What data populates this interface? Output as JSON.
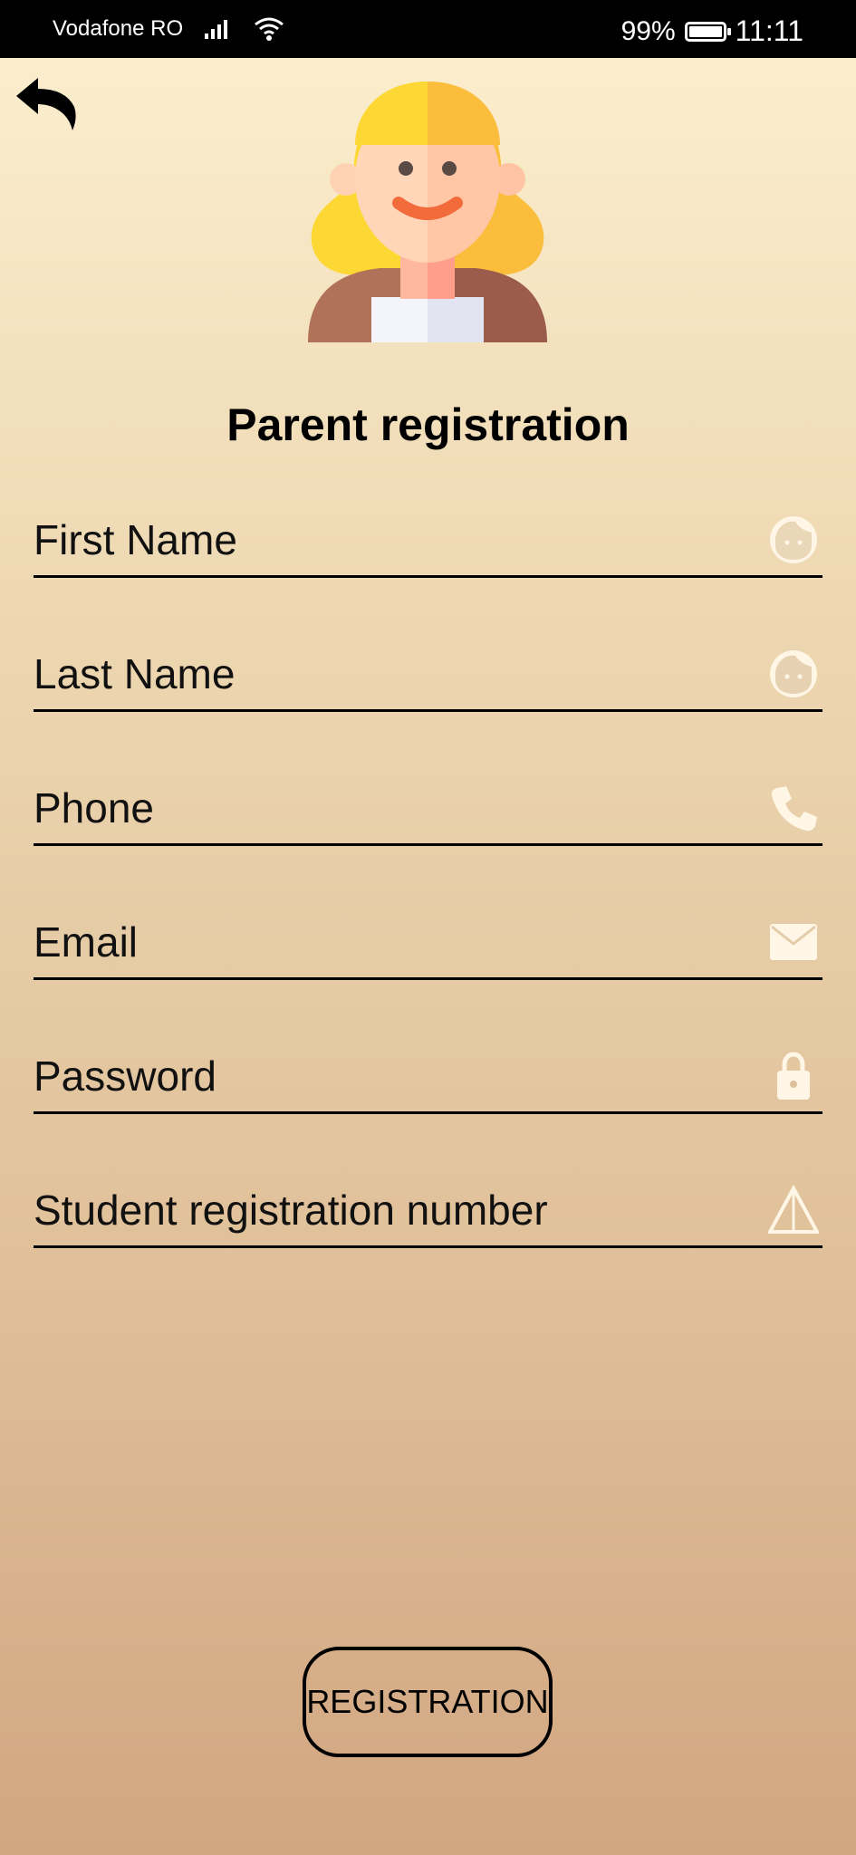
{
  "status_bar": {
    "carrier": "Vodafone RO",
    "battery": "99%",
    "time": "11:11"
  },
  "page": {
    "title": "Parent registration"
  },
  "form": {
    "first_name": {
      "placeholder": "First Name",
      "value": ""
    },
    "last_name": {
      "placeholder": "Last Name",
      "value": ""
    },
    "phone": {
      "placeholder": "Phone",
      "value": ""
    },
    "email": {
      "placeholder": "Email",
      "value": ""
    },
    "password": {
      "placeholder": "Password",
      "value": ""
    },
    "student_number": {
      "placeholder": "Student registration number",
      "value": ""
    }
  },
  "buttons": {
    "register": "REGISTRATION"
  },
  "colors": {
    "status_bar_bg": "#000000",
    "field_icon": "#fff6e6",
    "gradient_top": "#fdf0cf",
    "gradient_bottom": "#d1a681"
  }
}
